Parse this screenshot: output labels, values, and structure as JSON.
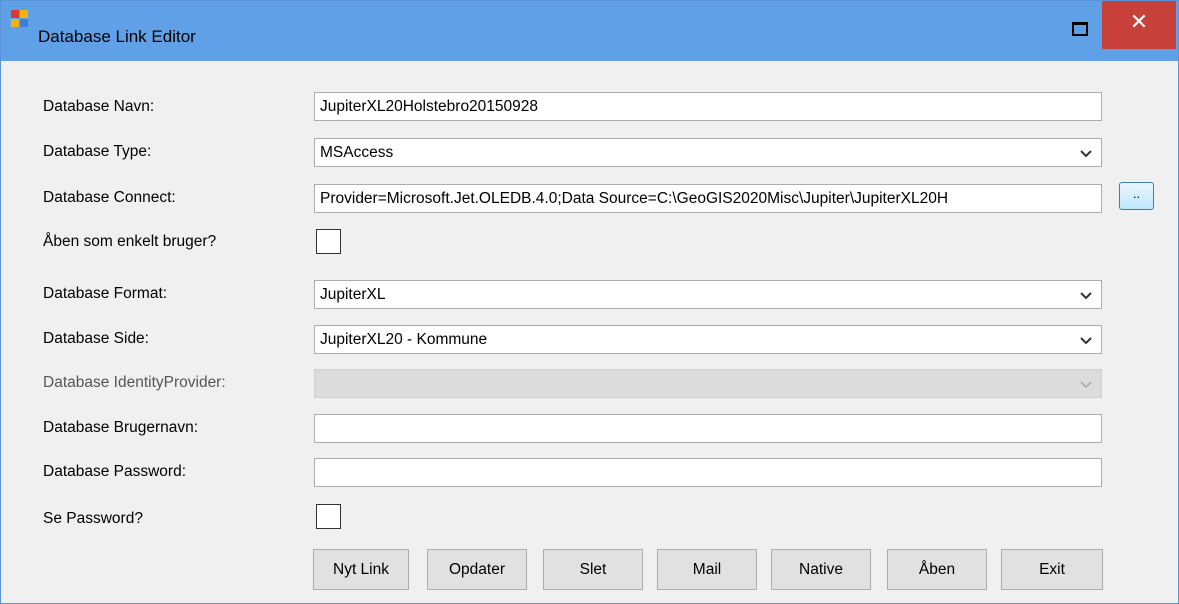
{
  "window": {
    "title": "Database Link Editor",
    "close_glyph": "✕",
    "icons": [
      "app-icon",
      "maximize-icon",
      "close-icon"
    ]
  },
  "form": {
    "name": {
      "label": "Database Navn:",
      "value": "JupiterXL20Holstebro20150928"
    },
    "type": {
      "label": "Database Type:",
      "value": "MSAccess"
    },
    "connect": {
      "label": "Database Connect:",
      "value": "Provider=Microsoft.Jet.OLEDB.4.0;Data Source=C:\\GeoGIS2020Misc\\Jupiter\\JupiterXL20H",
      "browse_label": ".."
    },
    "single_user": {
      "label": "Åben som enkelt bruger?",
      "checked": false
    },
    "format": {
      "label": "Database Format:",
      "value": "JupiterXL"
    },
    "side": {
      "label": "Database Side:",
      "value": "JupiterXL20 - Kommune"
    },
    "identity_provider": {
      "label": "Database IdentityProvider:",
      "value": "",
      "enabled": false
    },
    "username": {
      "label": "Database Brugernavn:",
      "value": ""
    },
    "password": {
      "label": "Database Password:",
      "value": ""
    },
    "show_password": {
      "label": "Se Password?",
      "checked": false
    }
  },
  "buttons": {
    "new_link": "Nyt Link",
    "update": "Opdater",
    "delete": "Slet",
    "mail": "Mail",
    "native": "Native",
    "open": "Åben",
    "exit": "Exit"
  },
  "colors": {
    "titlebar": "#5fa0e6",
    "close": "#c7403a",
    "background": "#f0f0f0"
  }
}
